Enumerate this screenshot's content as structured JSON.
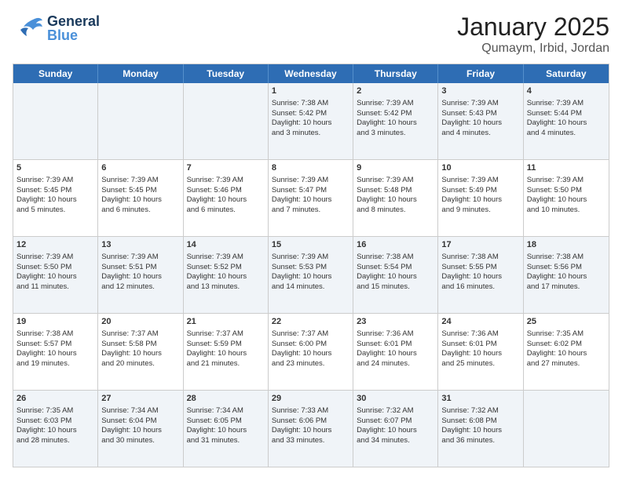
{
  "header": {
    "logo_general": "General",
    "logo_blue": "Blue",
    "title": "January 2025",
    "subtitle": "Qumaym, Irbid, Jordan"
  },
  "days": [
    "Sunday",
    "Monday",
    "Tuesday",
    "Wednesday",
    "Thursday",
    "Friday",
    "Saturday"
  ],
  "rows": [
    [
      {
        "num": "",
        "info": ""
      },
      {
        "num": "",
        "info": ""
      },
      {
        "num": "",
        "info": ""
      },
      {
        "num": "1",
        "info": "Sunrise: 7:38 AM\nSunset: 5:42 PM\nDaylight: 10 hours\nand 3 minutes."
      },
      {
        "num": "2",
        "info": "Sunrise: 7:39 AM\nSunset: 5:42 PM\nDaylight: 10 hours\nand 3 minutes."
      },
      {
        "num": "3",
        "info": "Sunrise: 7:39 AM\nSunset: 5:43 PM\nDaylight: 10 hours\nand 4 minutes."
      },
      {
        "num": "4",
        "info": "Sunrise: 7:39 AM\nSunset: 5:44 PM\nDaylight: 10 hours\nand 4 minutes."
      }
    ],
    [
      {
        "num": "5",
        "info": "Sunrise: 7:39 AM\nSunset: 5:45 PM\nDaylight: 10 hours\nand 5 minutes."
      },
      {
        "num": "6",
        "info": "Sunrise: 7:39 AM\nSunset: 5:45 PM\nDaylight: 10 hours\nand 6 minutes."
      },
      {
        "num": "7",
        "info": "Sunrise: 7:39 AM\nSunset: 5:46 PM\nDaylight: 10 hours\nand 6 minutes."
      },
      {
        "num": "8",
        "info": "Sunrise: 7:39 AM\nSunset: 5:47 PM\nDaylight: 10 hours\nand 7 minutes."
      },
      {
        "num": "9",
        "info": "Sunrise: 7:39 AM\nSunset: 5:48 PM\nDaylight: 10 hours\nand 8 minutes."
      },
      {
        "num": "10",
        "info": "Sunrise: 7:39 AM\nSunset: 5:49 PM\nDaylight: 10 hours\nand 9 minutes."
      },
      {
        "num": "11",
        "info": "Sunrise: 7:39 AM\nSunset: 5:50 PM\nDaylight: 10 hours\nand 10 minutes."
      }
    ],
    [
      {
        "num": "12",
        "info": "Sunrise: 7:39 AM\nSunset: 5:50 PM\nDaylight: 10 hours\nand 11 minutes."
      },
      {
        "num": "13",
        "info": "Sunrise: 7:39 AM\nSunset: 5:51 PM\nDaylight: 10 hours\nand 12 minutes."
      },
      {
        "num": "14",
        "info": "Sunrise: 7:39 AM\nSunset: 5:52 PM\nDaylight: 10 hours\nand 13 minutes."
      },
      {
        "num": "15",
        "info": "Sunrise: 7:39 AM\nSunset: 5:53 PM\nDaylight: 10 hours\nand 14 minutes."
      },
      {
        "num": "16",
        "info": "Sunrise: 7:38 AM\nSunset: 5:54 PM\nDaylight: 10 hours\nand 15 minutes."
      },
      {
        "num": "17",
        "info": "Sunrise: 7:38 AM\nSunset: 5:55 PM\nDaylight: 10 hours\nand 16 minutes."
      },
      {
        "num": "18",
        "info": "Sunrise: 7:38 AM\nSunset: 5:56 PM\nDaylight: 10 hours\nand 17 minutes."
      }
    ],
    [
      {
        "num": "19",
        "info": "Sunrise: 7:38 AM\nSunset: 5:57 PM\nDaylight: 10 hours\nand 19 minutes."
      },
      {
        "num": "20",
        "info": "Sunrise: 7:37 AM\nSunset: 5:58 PM\nDaylight: 10 hours\nand 20 minutes."
      },
      {
        "num": "21",
        "info": "Sunrise: 7:37 AM\nSunset: 5:59 PM\nDaylight: 10 hours\nand 21 minutes."
      },
      {
        "num": "22",
        "info": "Sunrise: 7:37 AM\nSunset: 6:00 PM\nDaylight: 10 hours\nand 23 minutes."
      },
      {
        "num": "23",
        "info": "Sunrise: 7:36 AM\nSunset: 6:01 PM\nDaylight: 10 hours\nand 24 minutes."
      },
      {
        "num": "24",
        "info": "Sunrise: 7:36 AM\nSunset: 6:01 PM\nDaylight: 10 hours\nand 25 minutes."
      },
      {
        "num": "25",
        "info": "Sunrise: 7:35 AM\nSunset: 6:02 PM\nDaylight: 10 hours\nand 27 minutes."
      }
    ],
    [
      {
        "num": "26",
        "info": "Sunrise: 7:35 AM\nSunset: 6:03 PM\nDaylight: 10 hours\nand 28 minutes."
      },
      {
        "num": "27",
        "info": "Sunrise: 7:34 AM\nSunset: 6:04 PM\nDaylight: 10 hours\nand 30 minutes."
      },
      {
        "num": "28",
        "info": "Sunrise: 7:34 AM\nSunset: 6:05 PM\nDaylight: 10 hours\nand 31 minutes."
      },
      {
        "num": "29",
        "info": "Sunrise: 7:33 AM\nSunset: 6:06 PM\nDaylight: 10 hours\nand 33 minutes."
      },
      {
        "num": "30",
        "info": "Sunrise: 7:32 AM\nSunset: 6:07 PM\nDaylight: 10 hours\nand 34 minutes."
      },
      {
        "num": "31",
        "info": "Sunrise: 7:32 AM\nSunset: 6:08 PM\nDaylight: 10 hours\nand 36 minutes."
      },
      {
        "num": "",
        "info": ""
      }
    ]
  ]
}
